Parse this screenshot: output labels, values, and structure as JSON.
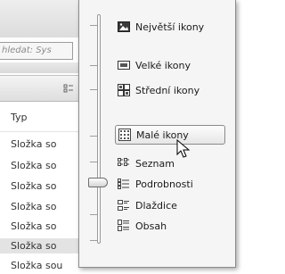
{
  "background": {
    "search_text": "hledat: Sys",
    "column_header": "Typ",
    "rows": [
      "Složka so",
      "Složka so",
      "Složka so",
      "Složka so",
      "Složka so",
      "Složka so",
      "Složka sou"
    ],
    "selected_row_index": 5
  },
  "menu": {
    "items": [
      {
        "label": "Největší ikony",
        "icon": "extra-large-icons-icon"
      },
      {
        "label": "Velké ikony",
        "icon": "large-icons-icon"
      },
      {
        "label": "Střední ikony",
        "icon": "medium-icons-icon"
      },
      {
        "label": "Malé ikony",
        "icon": "small-icons-icon",
        "hovered": true
      },
      {
        "label": "Seznam",
        "icon": "list-icon"
      },
      {
        "label": "Podrobnosti",
        "icon": "details-icon"
      },
      {
        "label": "Dlaždice",
        "icon": "tiles-icon"
      },
      {
        "label": "Obsah",
        "icon": "content-icon"
      }
    ],
    "view_slider_position": "Podrobnosti"
  },
  "colors": {
    "menu_background": "#f5f5f5",
    "hover_border": "#8a8a8a",
    "selected_row": "#e3e3e3"
  }
}
